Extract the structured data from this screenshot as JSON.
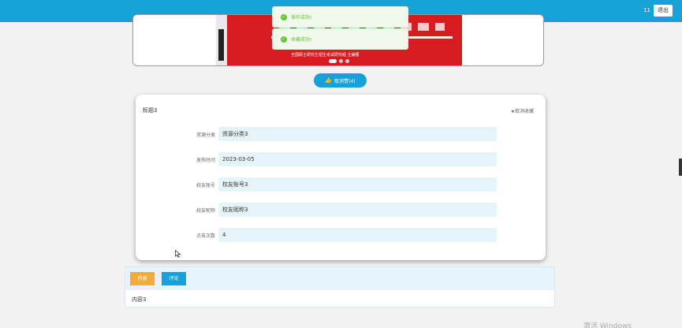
{
  "header": {
    "user": "11",
    "logout_label": "退出",
    "accent": "#15a2d6"
  },
  "carousel": {
    "publisher_text": "全国硕士研究生招生考试研究组 主编著",
    "dots": 3,
    "active_dot": 1
  },
  "toasts": [
    {
      "icon": "check-circle-icon",
      "text": "操作成功!"
    },
    {
      "icon": "check-circle-icon",
      "text": "收藏成功!"
    }
  ],
  "like_button": {
    "icon": "thumbs-up-icon",
    "label": "取消赞(4)"
  },
  "detail": {
    "title": "标题3",
    "favorite_label": "★取消收藏",
    "fields": [
      {
        "label": "资源分类",
        "value": "资源分类3"
      },
      {
        "label": "发布时间",
        "value": "2023-03-05"
      },
      {
        "label": "校友账号",
        "value": "校友账号3"
      },
      {
        "label": "校友昵称",
        "value": "校友昵称3"
      },
      {
        "label": "点击次数",
        "value": "4"
      }
    ]
  },
  "tabs": {
    "items": [
      {
        "label": "内容",
        "color": "#f0ad3a"
      },
      {
        "label": "评论",
        "color": "#15a2d6"
      }
    ],
    "content_text": "内容3"
  },
  "watermark": "激活 Windows"
}
